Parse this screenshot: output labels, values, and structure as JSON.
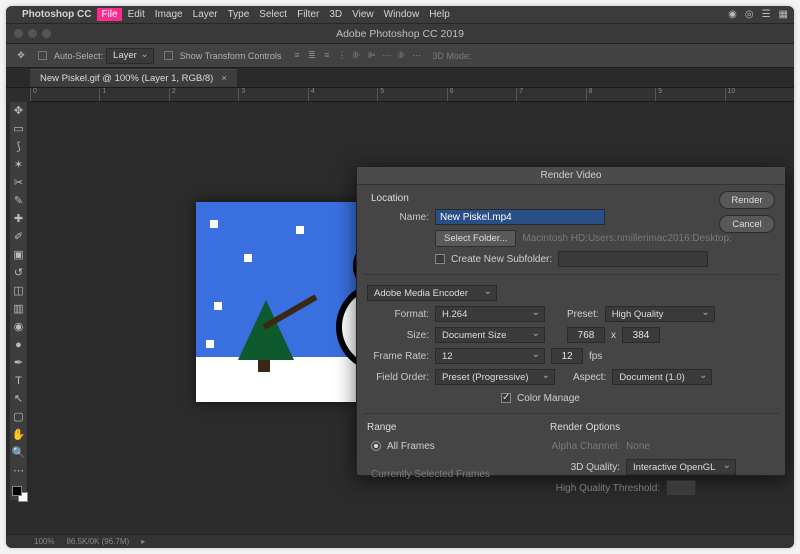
{
  "menubar": {
    "app": "Photoshop CC",
    "items": [
      "File",
      "Edit",
      "Image",
      "Layer",
      "Type",
      "Select",
      "Filter",
      "3D",
      "View",
      "Window",
      "Help"
    ],
    "highlighted_index": 0
  },
  "window_title": "Adobe Photoshop CC 2019",
  "options_bar": {
    "auto_select_label": "Auto-Select:",
    "auto_select_value": "Layer",
    "show_transform_label": "Show Transform Controls",
    "mode_label": "3D Mode:"
  },
  "document_tab": {
    "label": "New Piskel.gif @ 100% (Layer 1, RGB/8)"
  },
  "ruler_ticks": [
    "0",
    "1",
    "2",
    "3",
    "4",
    "5",
    "6",
    "7",
    "8",
    "9",
    "10"
  ],
  "status": {
    "zoom": "100%",
    "doc": "86.5K/0K (96.7M)"
  },
  "dialog": {
    "title": "Render Video",
    "buttons": {
      "render": "Render",
      "cancel": "Cancel"
    },
    "location_label": "Location",
    "name_label": "Name:",
    "name_value": "New Piskel.mp4",
    "select_folder_btn": "Select Folder...",
    "folder_path": "Macintosh HD:Users:nmillerimac2016:Desktop:",
    "create_subfolder_label": "Create New Subfolder:",
    "encoder": "Adobe Media Encoder",
    "format_label": "Format:",
    "format_value": "H.264",
    "preset_label": "Preset:",
    "preset_value": "High Quality",
    "size_label": "Size:",
    "size_value": "Document Size",
    "width": "768",
    "height": "384",
    "x": "x",
    "framerate_label": "Frame Rate:",
    "framerate_value": "12",
    "fps_value": "12",
    "fps_unit": "fps",
    "fieldorder_label": "Field Order:",
    "fieldorder_value": "Preset (Progressive)",
    "aspect_label": "Aspect:",
    "aspect_value": "Document (1.0)",
    "color_manage_label": "Color Manage",
    "range_label": "Range",
    "all_frames": "All Frames",
    "sel_frames": "Currently Selected Frames",
    "render_options_label": "Render Options",
    "alpha_label": "Alpha Channel:",
    "alpha_value": "None",
    "quality3d_label": "3D Quality:",
    "quality3d_value": "Interactive OpenGL",
    "hq_threshold_label": "High Quality Threshold:"
  }
}
